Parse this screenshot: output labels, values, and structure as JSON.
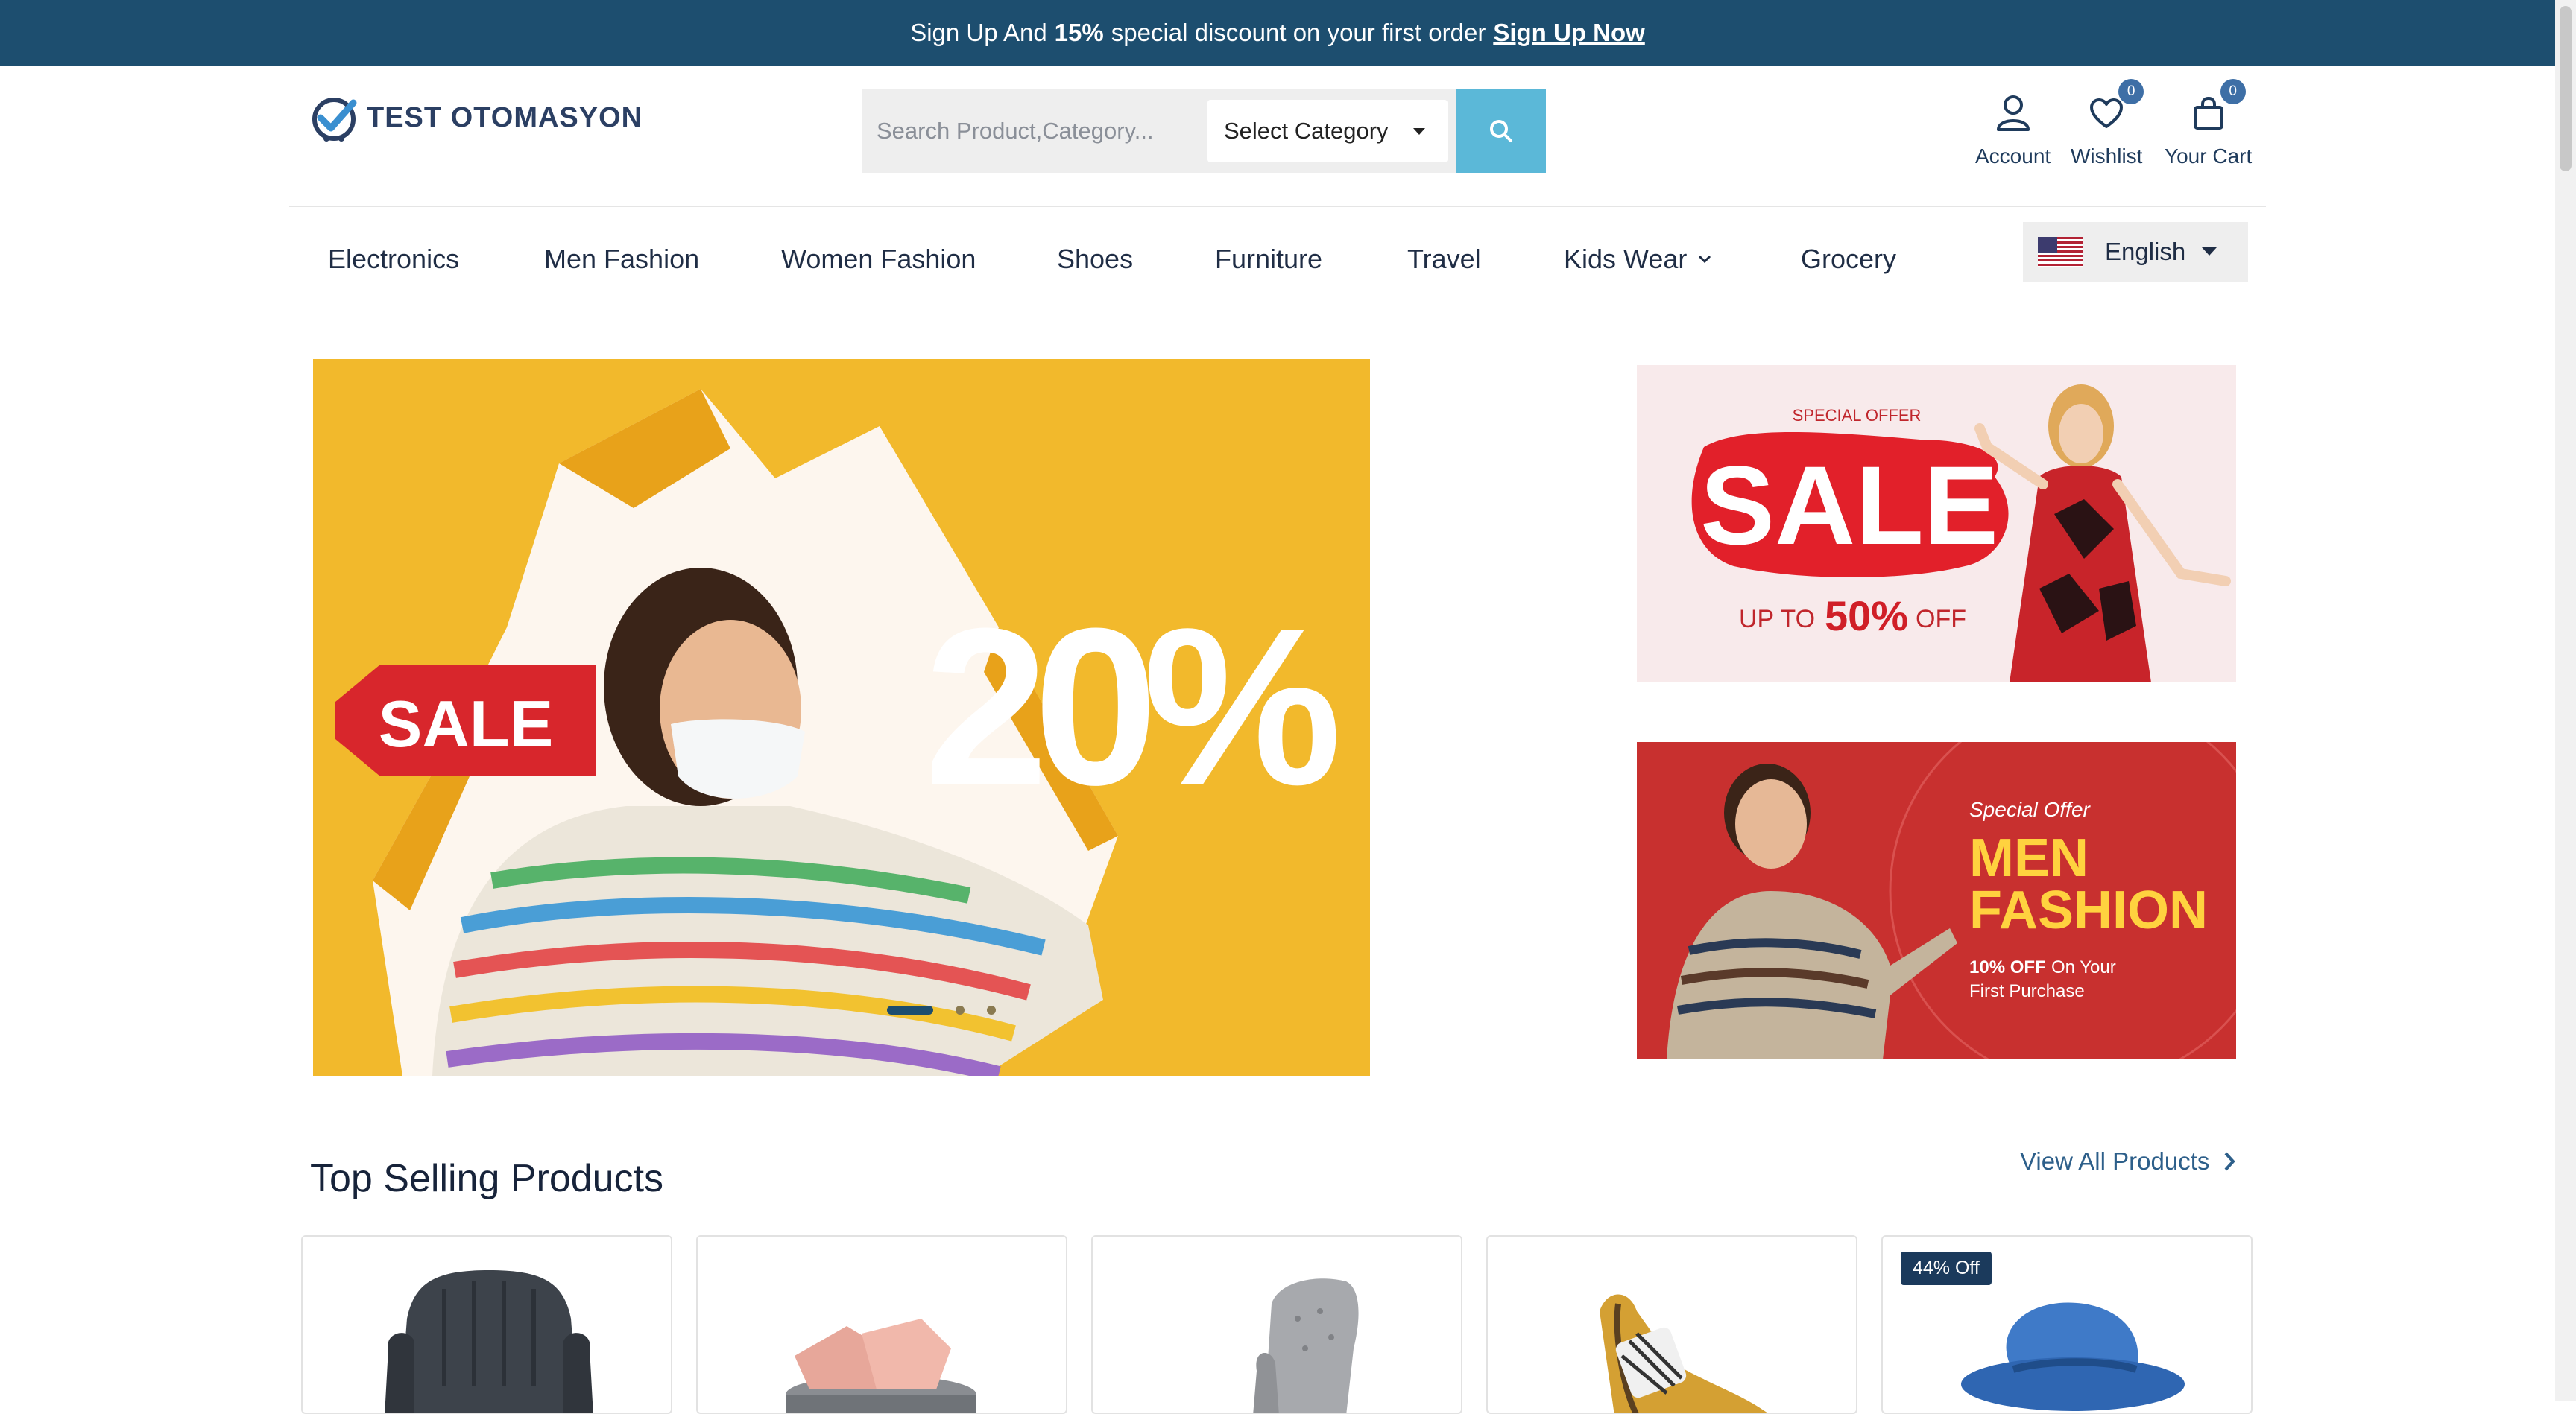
{
  "topbar": {
    "text_before": "Sign Up And",
    "discount": "15%",
    "text_after": "special discount on your first order",
    "signup_link": "Sign Up Now"
  },
  "logo": {
    "text": "TEST OTOMASYON"
  },
  "search": {
    "placeholder": "Search Product,Category...",
    "category_selected": "Select Category"
  },
  "header_actions": {
    "account": {
      "label": "Account"
    },
    "wishlist": {
      "label": "Wishlist",
      "count": "0"
    },
    "cart": {
      "label": "Your Cart",
      "count": "0"
    }
  },
  "nav": {
    "items": [
      "Electronics",
      "Men Fashion",
      "Women Fashion",
      "Shoes",
      "Furniture",
      "Travel",
      "Kids Wear",
      "Grocery"
    ]
  },
  "language": {
    "selected": "English"
  },
  "hero": {
    "sale_text": "SALE",
    "percent_text": "20%",
    "slides_count": 3,
    "active_slide": 1
  },
  "banners": {
    "sale": {
      "kicker": "SPECIAL OFFER",
      "headline": "SALE",
      "up_to": "UP TO",
      "percent": "50%",
      "off": "OFF"
    },
    "men": {
      "kicker": "Special Offer",
      "line1": "MEN",
      "line2": "FASHION",
      "detail_bold": "10% OFF",
      "detail_rest": "On Your",
      "detail_line2": "First Purchase"
    }
  },
  "section": {
    "title": "Top Selling Products",
    "view_all": "View All Products"
  },
  "products": [
    {
      "badge": ""
    },
    {
      "badge": ""
    },
    {
      "badge": ""
    },
    {
      "badge": ""
    },
    {
      "badge": "44% Off"
    }
  ],
  "colors": {
    "topbar_bg": "#1d4e6f",
    "search_button": "#5bb8d8",
    "hero_bg": "#f2b92c",
    "badge_bg": "#3e6fa6",
    "link": "#2d5f8a"
  }
}
